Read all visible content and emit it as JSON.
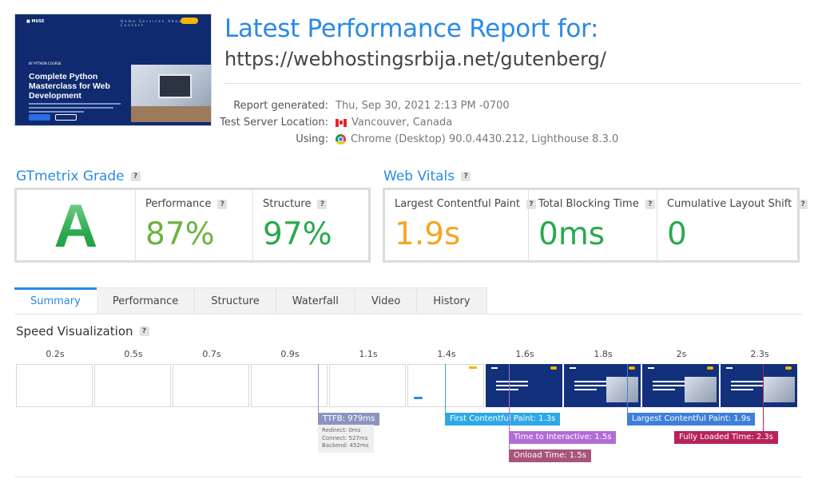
{
  "thumbnail": {
    "logo": "■ MUSE",
    "nav_links": "Home Services About Contact",
    "eyebrow": "BY PYTHON COURSE",
    "title": "Complete Python Masterclass for Web Development"
  },
  "report": {
    "title": "Latest Performance Report for:",
    "url": "https://webhostingsrbija.net/gutenberg/"
  },
  "meta": {
    "generated_label": "Report generated:",
    "generated_value": "Thu, Sep 30, 2021 2:13 PM -0700",
    "location_label": "Test Server Location:",
    "location_value": "Vancouver, Canada",
    "using_label": "Using:",
    "using_value": "Chrome (Desktop) 90.0.4430.212, Lighthouse 8.3.0"
  },
  "grade": {
    "heading": "GTmetrix Grade",
    "letter": "A",
    "performance_label": "Performance",
    "performance_value": "87%",
    "structure_label": "Structure",
    "structure_value": "97%"
  },
  "vitals": {
    "heading": "Web Vitals",
    "lcp_label": "Largest Contentful Paint",
    "lcp_value": "1.9s",
    "tbt_label": "Total Blocking Time",
    "tbt_value": "0ms",
    "cls_label": "Cumulative Layout Shift",
    "cls_value": "0"
  },
  "help_glyph": "?",
  "tabs": [
    {
      "label": "Summary",
      "active": true
    },
    {
      "label": "Performance"
    },
    {
      "label": "Structure"
    },
    {
      "label": "Waterfall"
    },
    {
      "label": "Video"
    },
    {
      "label": "History"
    }
  ],
  "speed": {
    "heading": "Speed Visualization",
    "times": [
      "0.2s",
      "0.5s",
      "0.7s",
      "0.9s",
      "1.1s",
      "1.4s",
      "1.6s",
      "1.8s",
      "2s",
      "2.3s"
    ],
    "ttfb": "TTFB: 979ms",
    "ttfb_redirect": "Redirect: 0ms",
    "ttfb_connect": "Connect: 527ms",
    "ttfb_backend": "Backend: 452ms",
    "fcp": "First Contentful Paint: 1.3s",
    "tti": "Time to Interactive: 1.5s",
    "onload": "Onload Time: 1.5s",
    "lcp": "Largest Contentful Paint: 1.9s",
    "fully_loaded": "Fully Loaded Time: 2.3s"
  },
  "colors": {
    "accent": "#2a8ae6",
    "grade_green": "#2aa94d",
    "lcp_orange": "#f5a623",
    "ttfb": "#8c95c2",
    "fcp": "#2fa8e6",
    "tti": "#b16cd6",
    "onload": "#a8557a",
    "lcp_marker": "#3f7fd9",
    "fully_loaded": "#b7245c"
  }
}
